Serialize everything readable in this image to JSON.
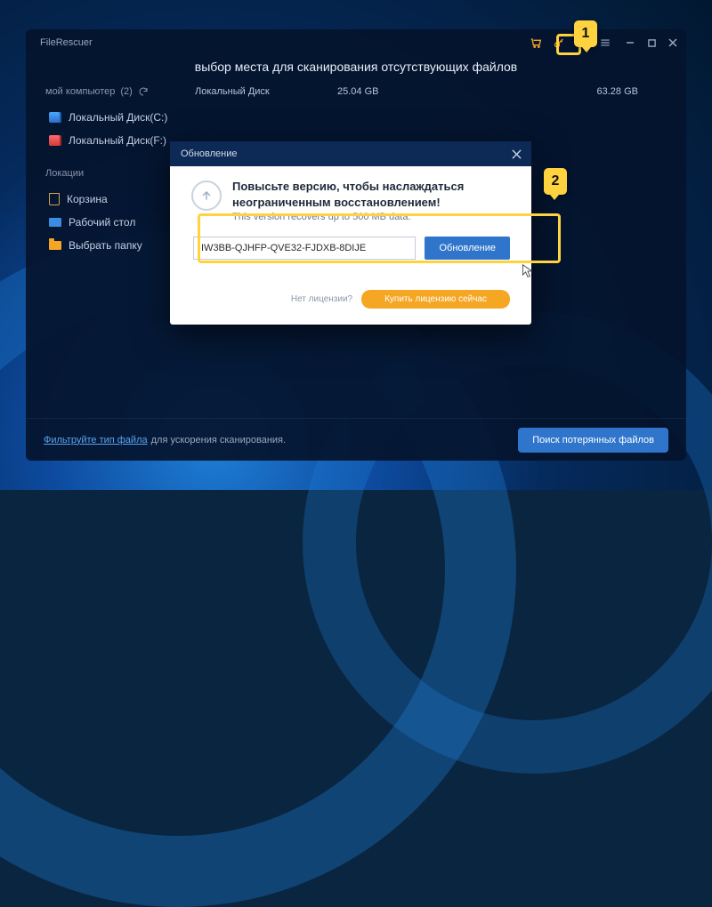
{
  "app": {
    "title": "FileRescuer"
  },
  "header": {
    "subtitle": "выбор места для сканирования отсутствующих файлов"
  },
  "sections": {
    "computer_label": "мой компьютер",
    "computer_count": "(2)",
    "locations_label": "Локации"
  },
  "drives": {
    "c": {
      "name": "Локальный Диск(C:)"
    },
    "f": {
      "name": "Локальный Диск(F:)"
    }
  },
  "row": {
    "type": "Локальный Диск",
    "used": "25.04 GB",
    "total": "63.28 GB"
  },
  "locations": {
    "trash": "Корзина",
    "desktop": "Рабочий стол",
    "choose": "Выбрать папку"
  },
  "footer": {
    "link": "Фильтруйте тип файла",
    "text": "для ускорения сканирования.",
    "scan": "Поиск потерянных файлов"
  },
  "modal": {
    "head": "Обновление",
    "title": "Повысьте версию, чтобы наслаждаться неограниченным восстановлением!",
    "sub": "This version recovers up to 500 MB data.",
    "license_value": "IW3BB-QJHFP-QVE32-FJDXB-8DIJE",
    "upgrade": "Обновление",
    "nolicense": "Нет лицензии?",
    "buy": "Купить лицензию сейчас"
  },
  "callouts": {
    "one": "1",
    "two": "2"
  }
}
